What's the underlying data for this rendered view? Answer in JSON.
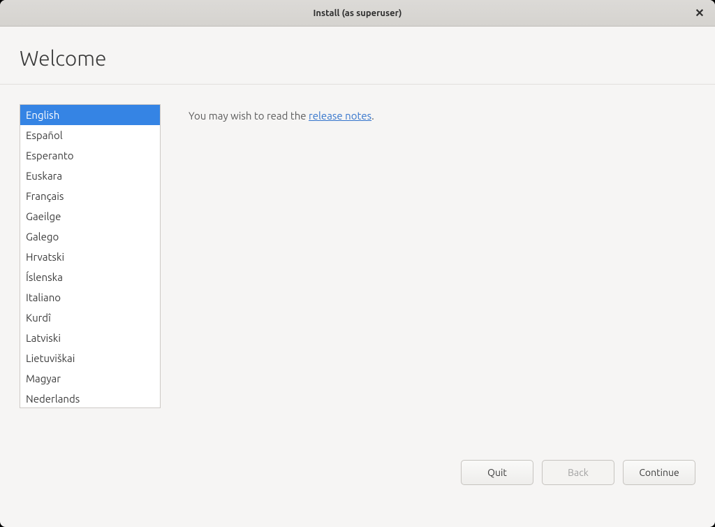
{
  "window": {
    "title": "Install (as superuser)"
  },
  "header": {
    "title": "Welcome"
  },
  "content": {
    "hint_prefix": "You may wish to read the ",
    "hint_link": "release notes",
    "hint_suffix": "."
  },
  "languages": {
    "selected_index": 0,
    "items": [
      "English",
      "Español",
      "Esperanto",
      "Euskara",
      "Français",
      "Gaeilge",
      "Galego",
      "Hrvatski",
      "Íslenska",
      "Italiano",
      "Kurdî",
      "Latviski",
      "Lietuviškai",
      "Magyar",
      "Nederlands"
    ]
  },
  "footer": {
    "quit": "Quit",
    "back": "Back",
    "continue": "Continue",
    "back_disabled": true
  }
}
